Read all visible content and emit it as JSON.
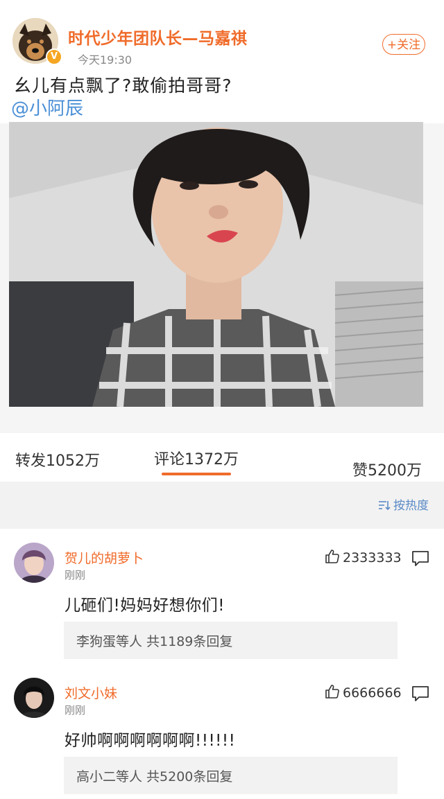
{
  "post": {
    "username": "时代少年团队长—马嘉祺",
    "verified_badge": "V",
    "time": "今天19:30",
    "follow_label": "+关注",
    "text": "幺儿有点飘了?敢偷拍哥哥?",
    "mention": "@小阿辰"
  },
  "stats": {
    "repost": "转发1052万",
    "comments": "评论1372万",
    "likes": "赞5200万"
  },
  "sort": {
    "label": "按热度",
    "icon": "sort-icon"
  },
  "comments": [
    {
      "name": "贺儿的胡萝卜",
      "time": "刚刚",
      "likes": "2333333",
      "text": "儿砸们!妈妈好想你们!",
      "replies": "李狗蛋等人 共1189条回复"
    },
    {
      "name": "刘文小妹",
      "time": "刚刚",
      "likes": "6666666",
      "text": "好帅啊啊啊啊啊啊!!!!!!",
      "replies": "高小二等人 共5200条回复"
    }
  ],
  "colors": {
    "accent": "#f06b2a",
    "link": "#4a8fd6",
    "sort": "#5a8ac6"
  }
}
